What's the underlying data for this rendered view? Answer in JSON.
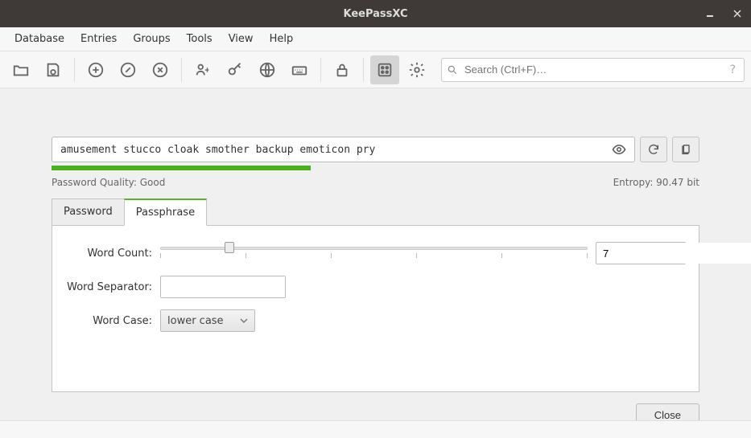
{
  "window": {
    "title": "KeePassXC"
  },
  "menu": {
    "items": [
      "Database",
      "Entries",
      "Groups",
      "Tools",
      "View",
      "Help"
    ]
  },
  "toolbar": {
    "search_placeholder": "Search (Ctrl+F)…"
  },
  "generator": {
    "password": "amusement stucco cloak smother backup emoticon pry",
    "quality_label": "Password Quality: Good",
    "entropy_label": "Entropy: 90.47 bit",
    "strength_percent": 40,
    "tabs": {
      "password": "Password",
      "passphrase": "Passphrase",
      "active": "passphrase"
    },
    "word_count_label": "Word Count:",
    "word_count_value": "7",
    "word_separator_label": "Word Separator:",
    "word_separator_value": "",
    "word_case_label": "Word Case:",
    "word_case_value": "lower case",
    "close_label": "Close"
  }
}
